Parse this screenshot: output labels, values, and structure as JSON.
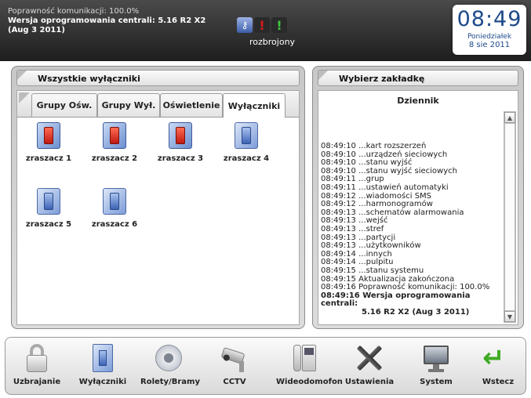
{
  "topbar": {
    "comm_status": "Poprawność komunikacji: 100.0%",
    "firmware_line": "Wersja oprogramowania centrali: 5.16 R2 X2",
    "firmware_date": "(Aug  3 2011)",
    "armed_status": "rozbrojony",
    "status_icons": [
      "key-icon",
      "warning-icon",
      "ok-icon"
    ],
    "clock": {
      "time": "08:49",
      "day": "Poniedziałek",
      "date": "8 sie 2011"
    }
  },
  "left_panel": {
    "title": "Wszystkie wyłączniki",
    "tabs": [
      {
        "label": "Grupy Ośw.",
        "active": false
      },
      {
        "label": "Grupy Wył.",
        "active": false
      },
      {
        "label": "Oświetlenie",
        "active": false
      },
      {
        "label": "Wyłączniki",
        "active": true
      }
    ],
    "switches": [
      {
        "label": "zraszacz 1",
        "state": "on"
      },
      {
        "label": "zraszacz 2",
        "state": "on"
      },
      {
        "label": "zraszacz 3",
        "state": "on"
      },
      {
        "label": "zraszacz 4",
        "state": "off"
      },
      {
        "label": "zraszacz 5",
        "state": "off"
      },
      {
        "label": "zraszacz 6",
        "state": "off"
      }
    ]
  },
  "right_panel": {
    "title": "Wybierz zakładkę",
    "log_title": "Dziennik",
    "log": [
      "08:49:10 ...kart rozszerzeń",
      "08:49:10 ...urządzeń sieciowych",
      "08:49:10 ...stanu wyjść",
      "08:49:10 ...stanu wyjść sieciowych",
      "08:49:11 ...grup",
      "08:49:11 ...ustawień automatyki",
      "08:49:12 ...wiadomości SMS",
      "08:49:12 ...harmonogramów",
      "08:49:13 ...schematów alarmowania",
      "08:49:13 ...wejść",
      "08:49:13 ...stref",
      "08:49:13 ...partycji",
      "08:49:13 ...użytkowników",
      "08:49:14 ...innych",
      "08:49:14 ...pulpitu",
      "08:49:15 ...stanu systemu",
      "08:49:15 Aktualizacja zakończona",
      "08:49:16 Poprawność komunikacji: 100.0%"
    ],
    "log_last": "08:49:16 Wersja oprogramowania centrali:",
    "log_last_cont": "5.16 R2 X2 (Aug  3 2011)"
  },
  "bottom_nav": [
    {
      "label": "Uzbrajanie",
      "icon": "lock-icon"
    },
    {
      "label": "Wyłączniki",
      "icon": "switch-icon"
    },
    {
      "label": "Rolety/Bramy",
      "icon": "blinds-icon"
    },
    {
      "label": "CCTV",
      "icon": "camera-icon"
    },
    {
      "label": "Wideodomofon",
      "icon": "intercom-icon"
    },
    {
      "label": "Ustawienia",
      "icon": "tools-icon"
    },
    {
      "label": "System",
      "icon": "monitor-icon"
    },
    {
      "label": "Wstecz",
      "icon": "back-arrow-icon"
    }
  ],
  "colors": {
    "accent_blue": "#1d4a8a",
    "switch_on": "#c01a10",
    "switch_off": "#3d63b5",
    "back_arrow": "#3eaa22"
  }
}
